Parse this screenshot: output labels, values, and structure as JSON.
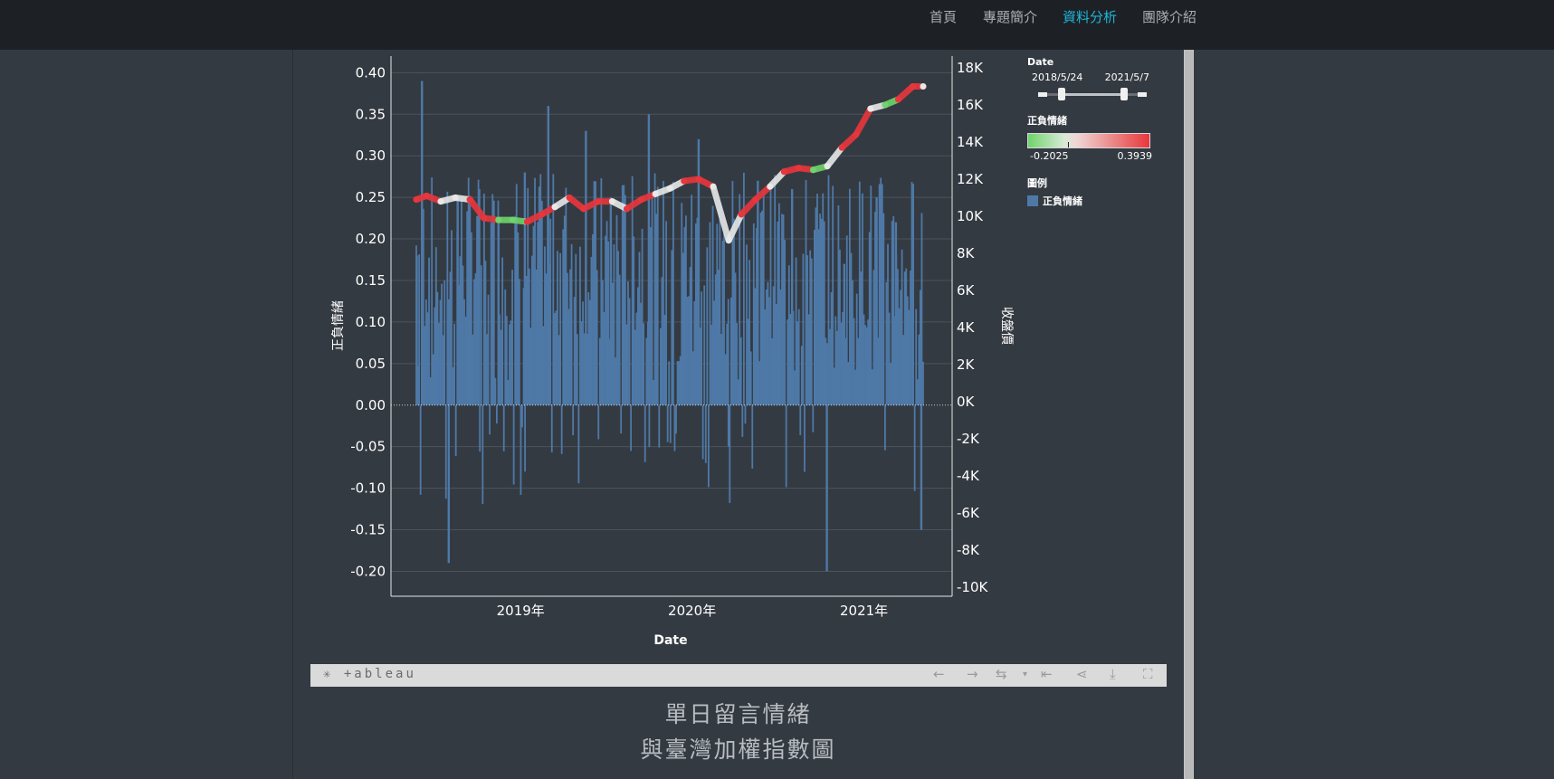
{
  "nav": {
    "items": [
      {
        "label": "首頁",
        "active": false
      },
      {
        "label": "專題簡介",
        "active": false
      },
      {
        "label": "資料分析",
        "active": true
      },
      {
        "label": "團隊介紹",
        "active": false
      }
    ]
  },
  "chart_data": {
    "type": "bar",
    "xlabel": "Date",
    "ylabel": "正負情緒",
    "y2label": "收盤價",
    "ylim": [
      -0.23,
      0.42
    ],
    "y2lim": [
      -10000,
      18000
    ],
    "yticks": [
      "0.40",
      "0.35",
      "0.30",
      "0.25",
      "0.20",
      "0.15",
      "0.10",
      "0.05",
      "0.00",
      "-0.05",
      "-0.10",
      "-0.15",
      "-0.20"
    ],
    "y2ticks": [
      "18K",
      "16K",
      "14K",
      "12K",
      "10K",
      "8K",
      "6K",
      "4K",
      "2K",
      "0K",
      "-2K",
      "-4K",
      "-6K",
      "-8K",
      "-10K"
    ],
    "xticks": [
      "2019年",
      "2020年",
      "2021年"
    ],
    "grid": true,
    "colors": {
      "bar": "#4e79a7",
      "line_low": "#6fd46b",
      "line_mid": "#e8e8e8",
      "line_high": "#e8363c"
    },
    "bar_series": {
      "name": "正負情緒",
      "note": "daily sentiment values, 2018-05-24 to 2021-05-07; dense daily bars mostly positive (0.05-0.30) with spikes to ~0.39 and dips to ~-0.20",
      "x": [
        "2018-05-25",
        "2018-06-05",
        "2018-08-01",
        "2018-08-20",
        "2018-10-05",
        "2018-11-15",
        "2019-01-10",
        "2019-03-01",
        "2019-05-20",
        "2019-07-12",
        "2019-10-01",
        "2020-01-15",
        "2020-03-19",
        "2020-05-20",
        "2020-08-01",
        "2020-10-14",
        "2020-11-20",
        "2021-01-28",
        "2021-03-10",
        "2021-04-15",
        "2021-05-03"
      ],
      "y": [
        0.18,
        0.39,
        -0.19,
        0.25,
        0.26,
        0.22,
        0.28,
        0.36,
        0.33,
        0.25,
        0.35,
        0.32,
        -0.05,
        0.27,
        0.26,
        -0.2,
        0.17,
        0.25,
        0.22,
        0.21,
        -0.15
      ]
    },
    "line_series": {
      "name": "收盤價",
      "x": [
        "2018-05-24",
        "2018-06-15",
        "2018-07-15",
        "2018-08-15",
        "2018-09-15",
        "2018-10-15",
        "2018-11-15",
        "2018-12-15",
        "2019-01-15",
        "2019-02-15",
        "2019-03-15",
        "2019-04-15",
        "2019-05-15",
        "2019-06-15",
        "2019-07-15",
        "2019-08-15",
        "2019-09-15",
        "2019-10-15",
        "2019-11-15",
        "2019-12-15",
        "2020-01-15",
        "2020-02-15",
        "2020-03-19",
        "2020-04-15",
        "2020-05-15",
        "2020-06-15",
        "2020-07-15",
        "2020-08-15",
        "2020-09-15",
        "2020-10-15",
        "2020-11-15",
        "2020-12-15",
        "2021-01-15",
        "2021-02-15",
        "2021-03-15",
        "2021-04-15",
        "2021-05-07"
      ],
      "y": [
        10900,
        11100,
        10800,
        11000,
        10900,
        9900,
        9800,
        9800,
        9700,
        10100,
        10500,
        11000,
        10400,
        10800,
        10800,
        10400,
        10900,
        11200,
        11500,
        11900,
        12000,
        11600,
        8700,
        10100,
        10900,
        11600,
        12400,
        12600,
        12500,
        12700,
        13700,
        14400,
        15800,
        16000,
        16300,
        17000,
        17000
      ]
    }
  },
  "legend": {
    "date_title": "Date",
    "date_start": "2018/5/24",
    "date_end": "2021/5/7",
    "color_title": "正負情緒",
    "color_min": "-0.2025",
    "color_max": "0.3939",
    "series_title": "圖例",
    "series_item": "正負情緒"
  },
  "tableau": {
    "logo": "+ableau"
  },
  "caption": {
    "line1": "單日留言情緒",
    "line2": "與臺灣加權指數圖"
  }
}
